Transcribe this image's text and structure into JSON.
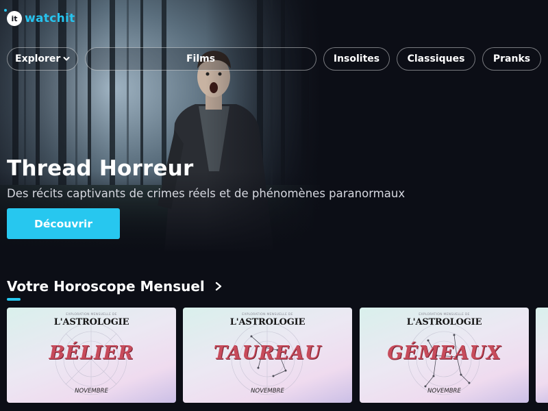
{
  "app": {
    "logo_mark": "it",
    "logo_text": "watchit"
  },
  "nav": {
    "explorer": "Explorer",
    "films": "Films",
    "insolites": "Insolites",
    "classiques": "Classiques",
    "pranks": "Pranks"
  },
  "hero": {
    "title": "Thread Horreur",
    "subtitle": "Des récits captivants de crimes réels et de phénomènes paranormaux",
    "button": "Découvrir"
  },
  "section": {
    "title": "Votre Horoscope Mensuel"
  },
  "cards": [
    {
      "kicker": "EXPLORATION MENSUELLE DE",
      "brand": "L'ASTROLOGIE",
      "sign": "BÉLIER",
      "month": "NOVEMBRE"
    },
    {
      "kicker": "EXPLORATION MENSUELLE DE",
      "brand": "L'ASTROLOGIE",
      "sign": "TAUREAU",
      "month": "NOVEMBRE"
    },
    {
      "kicker": "EXPLORATION MENSUELLE DE",
      "brand": "L'ASTROLOGIE",
      "sign": "GÉMEAUX",
      "month": "NOVEMBRE"
    }
  ],
  "colors": {
    "accent": "#27c7ef",
    "background": "#0c0e16",
    "sign_red": "#c74b5b"
  },
  "icons": {
    "nav_dropdown": "chevron-down-icon",
    "section_more": "chevron-right-icon"
  }
}
